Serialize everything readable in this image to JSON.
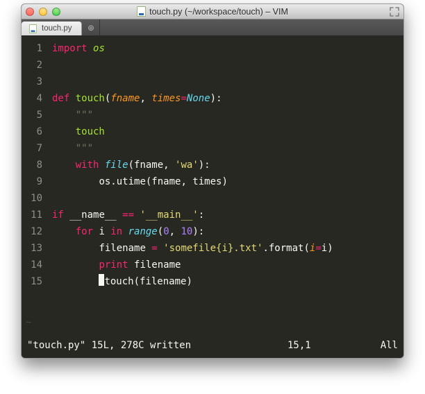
{
  "window": {
    "title": "touch.py (~/workspace/touch) – VIM"
  },
  "tabs": {
    "active": {
      "label": "touch.py"
    },
    "new_tab_glyph": "⊕"
  },
  "code": {
    "lines": [
      {
        "n": "1",
        "tokens": [
          {
            "t": "import ",
            "c": "kw"
          },
          {
            "t": "os",
            "c": "module"
          }
        ]
      },
      {
        "n": "2",
        "tokens": []
      },
      {
        "n": "3",
        "tokens": []
      },
      {
        "n": "4",
        "tokens": [
          {
            "t": "def ",
            "c": "kw"
          },
          {
            "t": "touch",
            "c": "defname"
          },
          {
            "t": "(",
            "c": "plain"
          },
          {
            "t": "fname",
            "c": "param"
          },
          {
            "t": ", ",
            "c": "plain"
          },
          {
            "t": "times",
            "c": "param"
          },
          {
            "t": "=",
            "c": "kw"
          },
          {
            "t": "None",
            "c": "builtin"
          },
          {
            "t": "):",
            "c": "plain"
          }
        ]
      },
      {
        "n": "5",
        "tokens": [
          {
            "t": "    ",
            "c": "plain"
          },
          {
            "t": "\"\"\"",
            "c": "docq"
          }
        ]
      },
      {
        "n": "6",
        "tokens": [
          {
            "t": "    ",
            "c": "plain"
          },
          {
            "t": "touch",
            "c": "defname"
          }
        ]
      },
      {
        "n": "7",
        "tokens": [
          {
            "t": "    ",
            "c": "plain"
          },
          {
            "t": "\"\"\"",
            "c": "docq"
          }
        ]
      },
      {
        "n": "8",
        "tokens": [
          {
            "t": "    ",
            "c": "plain"
          },
          {
            "t": "with ",
            "c": "kw"
          },
          {
            "t": "file",
            "c": "builtin"
          },
          {
            "t": "(fname, ",
            "c": "plain"
          },
          {
            "t": "'wa'",
            "c": "str"
          },
          {
            "t": "):",
            "c": "plain"
          }
        ]
      },
      {
        "n": "9",
        "tokens": [
          {
            "t": "        ",
            "c": "plain"
          },
          {
            "t": "os.utime(fname, times)",
            "c": "plain"
          }
        ]
      },
      {
        "n": "10",
        "tokens": []
      },
      {
        "n": "11",
        "tokens": [
          {
            "t": "if ",
            "c": "kw"
          },
          {
            "t": "__name__ ",
            "c": "plain"
          },
          {
            "t": "== ",
            "c": "kw"
          },
          {
            "t": "'__main__'",
            "c": "str"
          },
          {
            "t": ":",
            "c": "plain"
          }
        ]
      },
      {
        "n": "12",
        "tokens": [
          {
            "t": "    ",
            "c": "plain"
          },
          {
            "t": "for ",
            "c": "kw"
          },
          {
            "t": "i ",
            "c": "plain"
          },
          {
            "t": "in ",
            "c": "kw"
          },
          {
            "t": "range",
            "c": "builtin"
          },
          {
            "t": "(",
            "c": "plain"
          },
          {
            "t": "0",
            "c": "num"
          },
          {
            "t": ", ",
            "c": "plain"
          },
          {
            "t": "10",
            "c": "num"
          },
          {
            "t": "):",
            "c": "plain"
          }
        ]
      },
      {
        "n": "13",
        "tokens": [
          {
            "t": "        ",
            "c": "plain"
          },
          {
            "t": "filename ",
            "c": "plain"
          },
          {
            "t": "= ",
            "c": "kw"
          },
          {
            "t": "'somefile{i}.txt'",
            "c": "str"
          },
          {
            "t": ".format(",
            "c": "plain"
          },
          {
            "t": "i",
            "c": "param"
          },
          {
            "t": "=",
            "c": "kw"
          },
          {
            "t": "i)",
            "c": "plain"
          }
        ]
      },
      {
        "n": "14",
        "tokens": [
          {
            "t": "        ",
            "c": "plain"
          },
          {
            "t": "print ",
            "c": "kw"
          },
          {
            "t": "filename",
            "c": "plain"
          }
        ]
      },
      {
        "n": "15",
        "tokens": [
          {
            "t": "        ",
            "c": "plain"
          },
          {
            "cursor": true
          },
          {
            "t": "touch(filename)",
            "c": "plain"
          }
        ]
      }
    ],
    "tilde": "~"
  },
  "status": {
    "message": "\"touch.py\" 15L, 278C written",
    "position": "15,1",
    "scroll": "All"
  }
}
